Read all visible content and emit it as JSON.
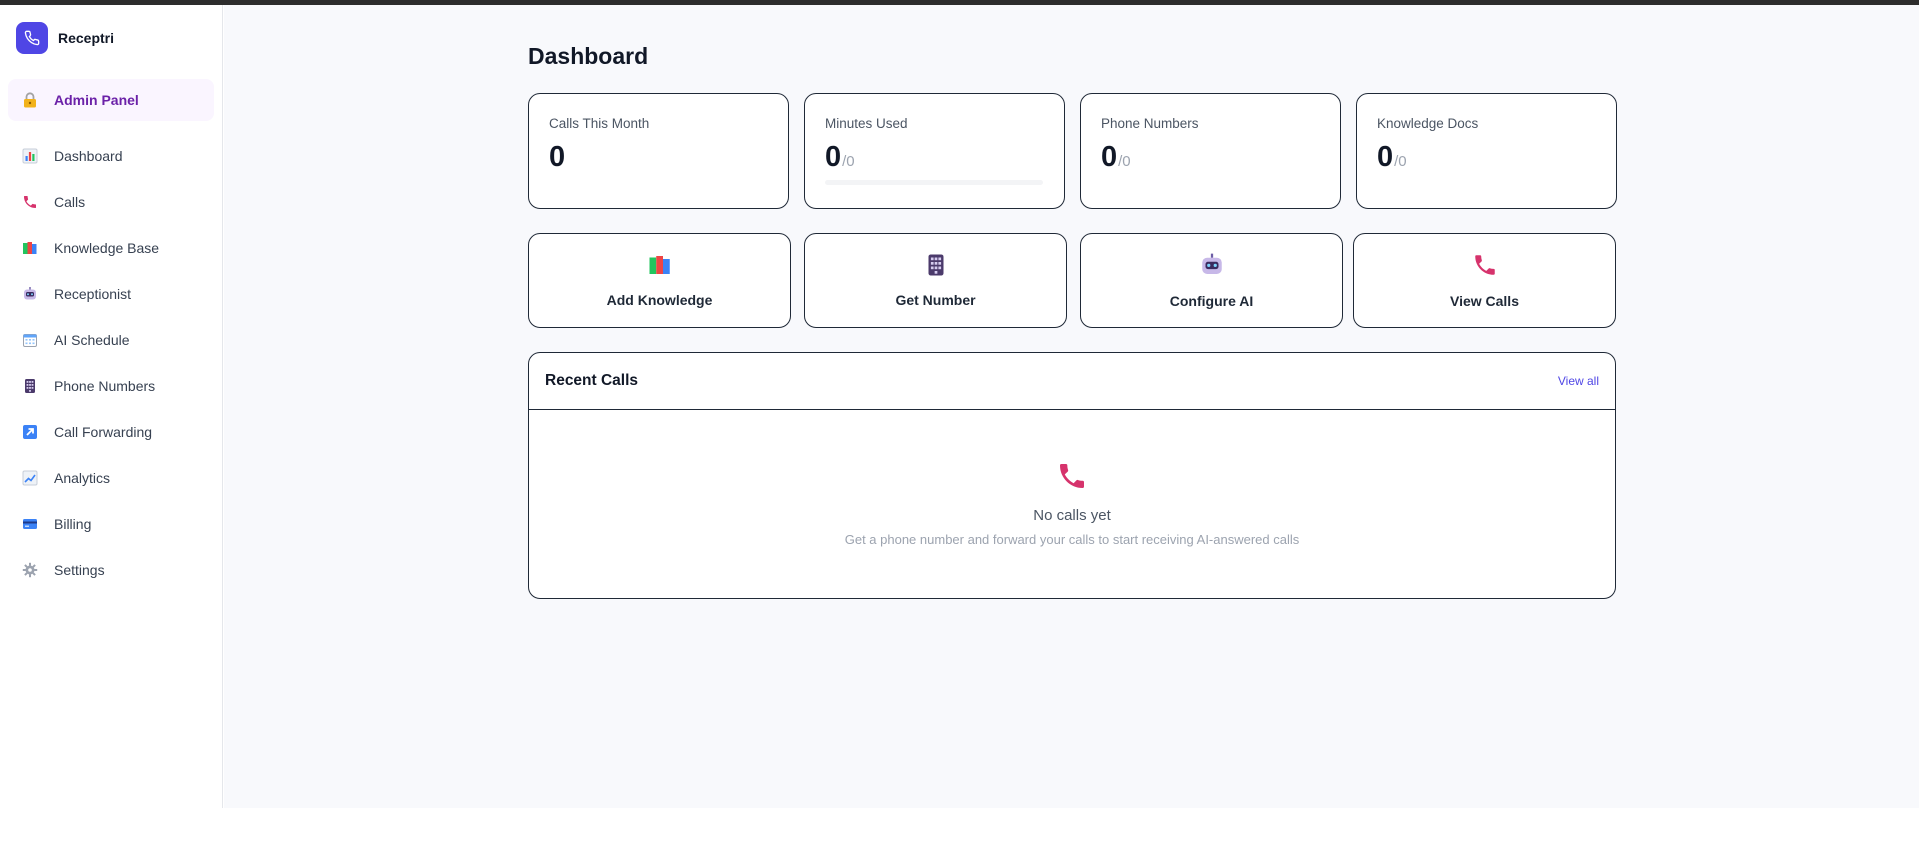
{
  "brand": {
    "name": "Receptri"
  },
  "sidebar": {
    "admin": {
      "label": "Admin Panel",
      "icon": "lock-icon"
    },
    "items": [
      {
        "label": "Dashboard",
        "icon": "bar-chart-icon"
      },
      {
        "label": "Calls",
        "icon": "phone-icon"
      },
      {
        "label": "Knowledge Base",
        "icon": "books-icon"
      },
      {
        "label": "Receptionist",
        "icon": "robot-icon"
      },
      {
        "label": "AI Schedule",
        "icon": "calendar-icon"
      },
      {
        "label": "Phone Numbers",
        "icon": "keypad-icon"
      },
      {
        "label": "Call Forwarding",
        "icon": "arrow-up-right-icon"
      },
      {
        "label": "Analytics",
        "icon": "line-chart-icon"
      },
      {
        "label": "Billing",
        "icon": "credit-card-icon"
      },
      {
        "label": "Settings",
        "icon": "gear-icon"
      }
    ]
  },
  "main": {
    "title": "Dashboard",
    "stats": [
      {
        "label": "Calls This Month",
        "value": "0",
        "denominator": ""
      },
      {
        "label": "Minutes Used",
        "value": "0",
        "denominator": "/0",
        "progress_percent": 0
      },
      {
        "label": "Phone Numbers",
        "value": "0",
        "denominator": "/0"
      },
      {
        "label": "Knowledge Docs",
        "value": "0",
        "denominator": "/0"
      }
    ],
    "actions": [
      {
        "label": "Add Knowledge",
        "icon": "books-icon"
      },
      {
        "label": "Get Number",
        "icon": "keypad-icon"
      },
      {
        "label": "Configure AI",
        "icon": "robot-icon"
      },
      {
        "label": "View Calls",
        "icon": "phone-icon"
      }
    ],
    "recent_calls": {
      "title": "Recent Calls",
      "view_all": "View all",
      "empty_title": "No calls yet",
      "empty_subtitle": "Get a phone number and forward your calls to start receiving AI-answered calls"
    }
  },
  "colors": {
    "accent": "#4f46e5",
    "admin_text": "#6b21a8",
    "admin_bg": "#faf5ff",
    "phone_pink": "#d6336c"
  }
}
